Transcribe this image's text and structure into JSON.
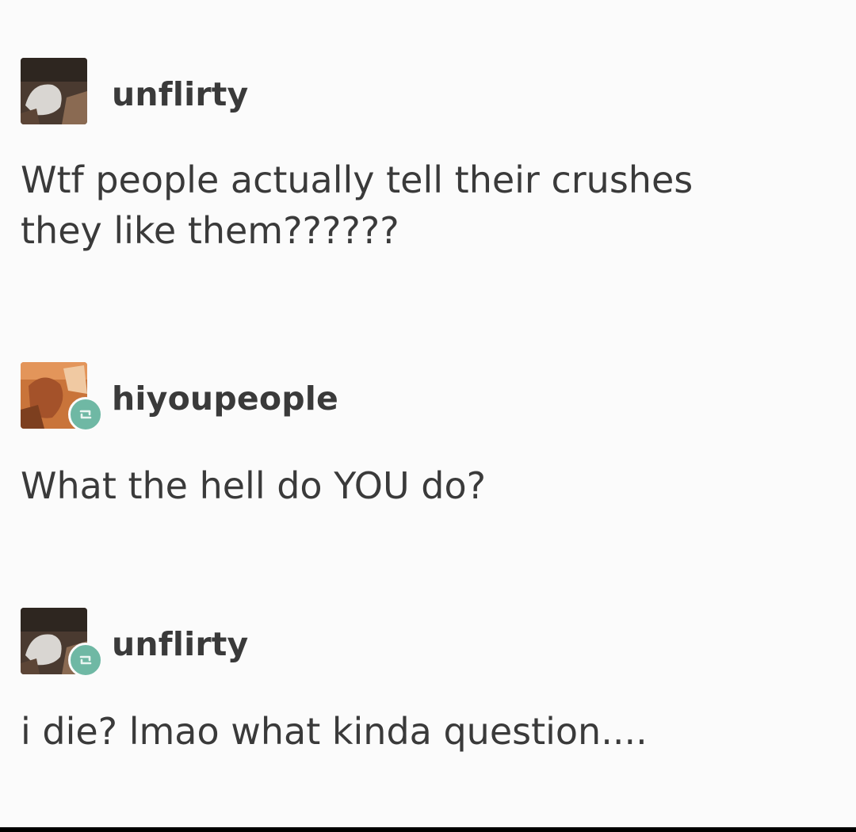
{
  "posts": [
    {
      "username": "unflirty",
      "avatar": "avatar-unflirty",
      "reblog_badge": false,
      "lines": [
        "Wtf people actually tell their crushes",
        "they like them??????"
      ]
    },
    {
      "username": "hiyoupeople",
      "avatar": "avatar-hiyoupeople",
      "reblog_badge": true,
      "lines": [
        "What the hell do YOU do?"
      ]
    },
    {
      "username": "unflirty",
      "avatar": "avatar-unflirty",
      "reblog_badge": true,
      "lines": [
        "i die? lmao what kinda question...."
      ]
    }
  ],
  "colors": {
    "background": "#fbfbfb",
    "text": "#3a3a3a",
    "reblog_badge": "#6fb8a4"
  },
  "icons": {
    "reblog": "reblog-icon"
  }
}
